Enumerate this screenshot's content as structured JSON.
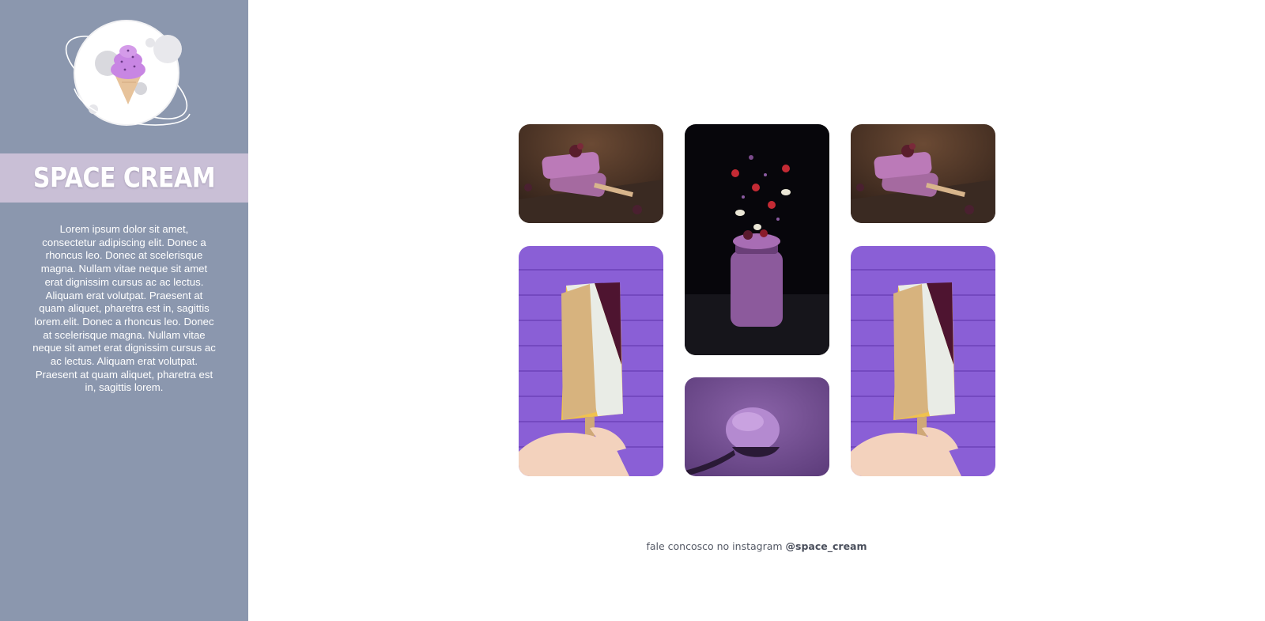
{
  "brand": {
    "title": "SPACE CREAM",
    "description": "Lorem ipsum dolor sit amet, consectetur adipiscing elit. Donec a rhoncus leo. Donec at scelerisque magna. Nullam vitae neque sit amet erat dignissim cursus ac ac lectus. Aliquam erat volutpat. Praesent at quam aliquet, pharetra est in, sagittis lorem.elit. Donec a rhoncus leo. Donec at scelerisque magna. Nullam vitae neque sit amet erat dignissim cursus ac ac lectus. Aliquam erat volutpat. Praesent at quam aliquet, pharetra est in, sagittis lorem.",
    "logo_icon": "ice-cream-planet-icon"
  },
  "gallery": {
    "photos": [
      {
        "subject": "purple popsicles with blackberries"
      },
      {
        "subject": "smoothie jar with falling fruit"
      },
      {
        "subject": "purple popsicles with blackberries"
      },
      {
        "subject": "yogurt popsicle with granola on purple brick wall"
      },
      {
        "subject": "spoon of purple ice cream"
      },
      {
        "subject": "yogurt popsicle with granola on purple brick wall"
      }
    ]
  },
  "footer": {
    "text": "fale concosco no instagram",
    "handle": "@space_cream"
  },
  "colors": {
    "sidebar": "#8b97ae",
    "band": "#c9bfd6",
    "background": "#ffffff"
  }
}
